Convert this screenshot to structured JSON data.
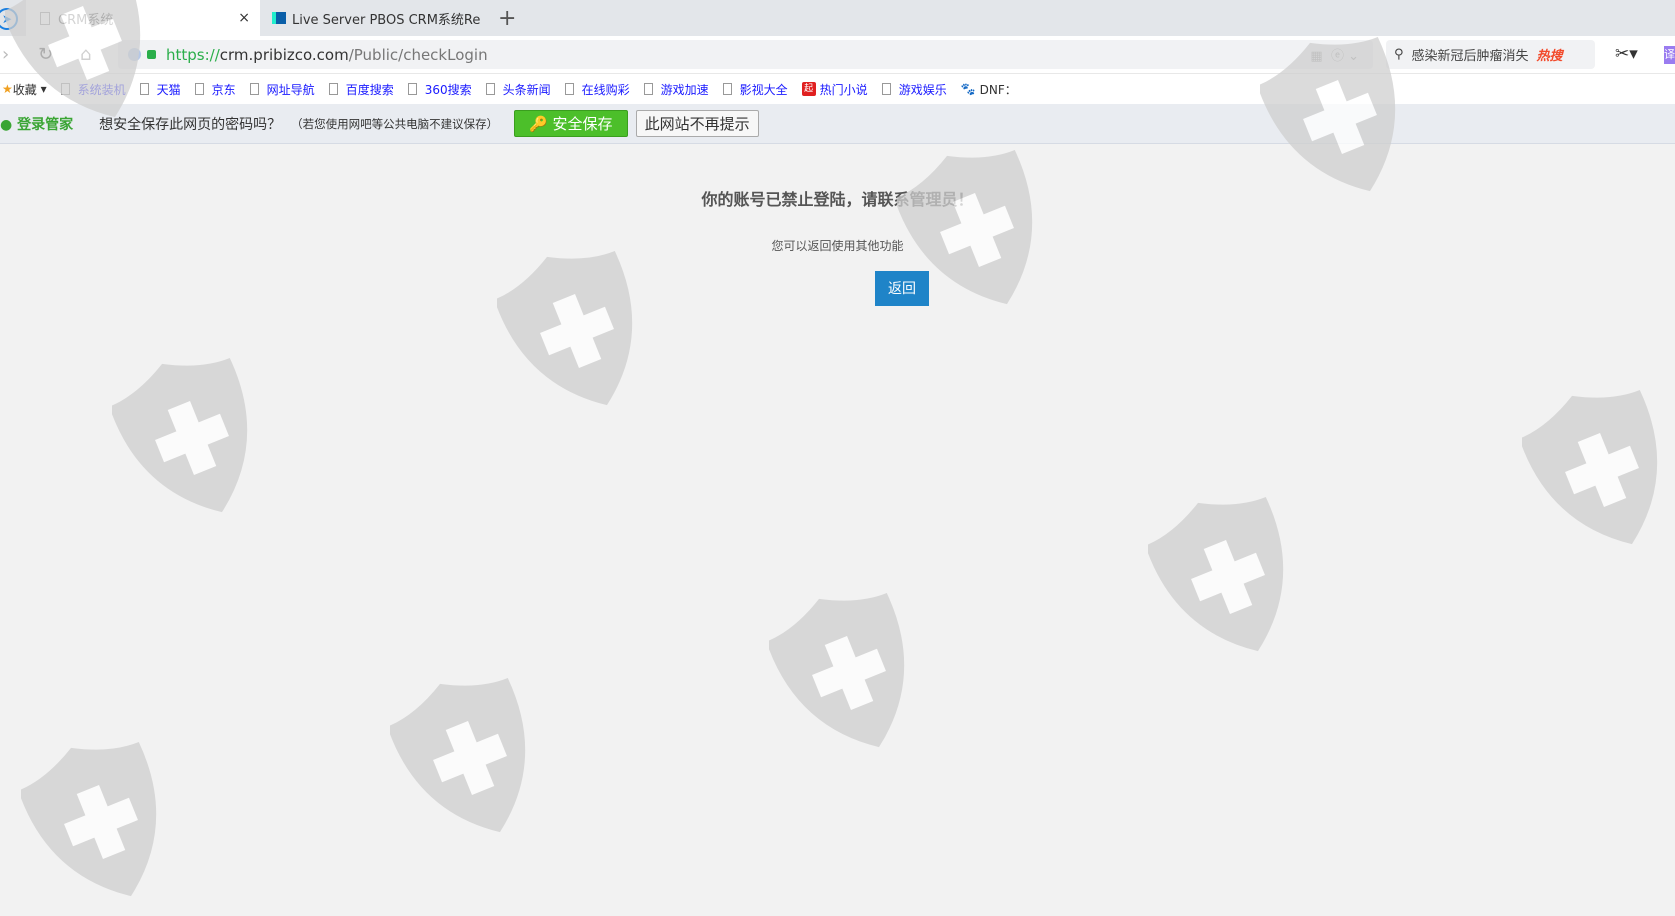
{
  "tabs": [
    {
      "label": "CRM系统",
      "close": "×"
    },
    {
      "label": "Live Server PBOS CRM系统Re"
    }
  ],
  "new_tab": "+",
  "address": {
    "scheme": "https://",
    "host": "crm.pribizco.com",
    "path": "/Public/checkLogin"
  },
  "search": {
    "text": "感染新冠后肿瘤消失",
    "hot": "热搜"
  },
  "translate": "译",
  "bookmarks": {
    "favorites": "收藏",
    "items": [
      "系统装机",
      "天猫",
      "京东",
      "网址导航",
      "百度搜索",
      "360搜索",
      "头条新闻",
      "在线购彩",
      "游戏加速",
      "影视大全",
      "热门小说",
      "游戏娱乐",
      "DNF："
    ],
    "novel_badge": "起"
  },
  "password_bar": {
    "brand": "登录管家",
    "question": "想安全保存此网页的密码吗？",
    "note": "（若您使用网吧等公共电脑不建议保存）",
    "save": "安全保存",
    "never": "此网站不再提示"
  },
  "page": {
    "title": "你的账号已禁止登陆，请联系管理员！",
    "subtitle": "您可以返回使用其他功能",
    "back": "返回"
  }
}
